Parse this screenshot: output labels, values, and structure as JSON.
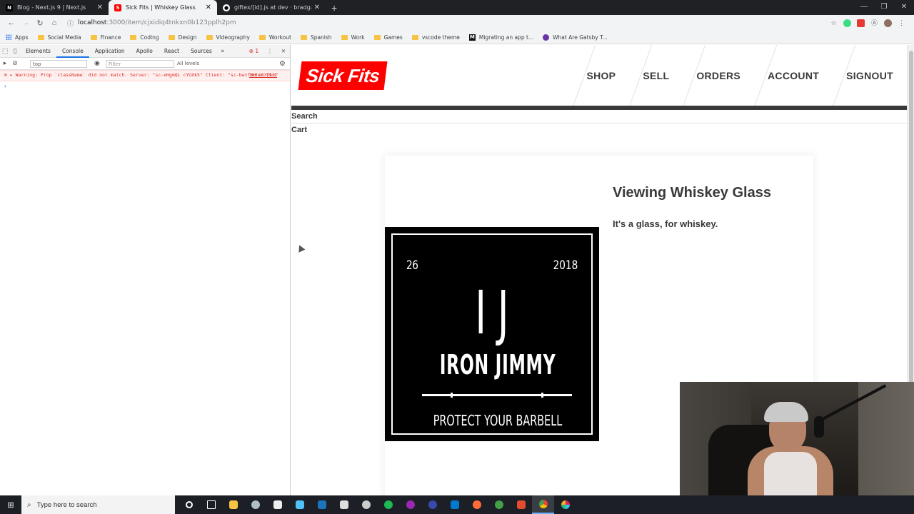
{
  "browser": {
    "tabs": [
      {
        "title": "Blog - Next.js 9 | Next.js",
        "icon": "nextjs-favicon",
        "active": false
      },
      {
        "title": "Sick Fits | Whiskey Glass",
        "icon": "sickfits-favicon",
        "active": true
      },
      {
        "title": "giftex/[id].js at dev · bradgarrop...",
        "icon": "github-favicon",
        "active": false
      }
    ],
    "url_host": "localhost",
    "url_path": ":3000/item/cjxidiq4tnkxn0b123pplh2pm",
    "bookmarks": [
      {
        "label": "Apps",
        "icon": "apps-grid-icon"
      },
      {
        "label": "Social Media",
        "icon": "folder-icon"
      },
      {
        "label": "Finance",
        "icon": "folder-icon"
      },
      {
        "label": "Coding",
        "icon": "folder-icon"
      },
      {
        "label": "Design",
        "icon": "folder-icon"
      },
      {
        "label": "Videography",
        "icon": "folder-icon"
      },
      {
        "label": "Workout",
        "icon": "folder-icon"
      },
      {
        "label": "Spanish",
        "icon": "folder-icon"
      },
      {
        "label": "Work",
        "icon": "folder-icon"
      },
      {
        "label": "Games",
        "icon": "folder-icon"
      },
      {
        "label": "vscode theme",
        "icon": "folder-icon"
      },
      {
        "label": "Migrating an app t...",
        "icon": "medium-icon"
      },
      {
        "label": "What Are Gatsby T...",
        "icon": "gatsby-icon"
      }
    ]
  },
  "devtools": {
    "tabs": [
      "Elements",
      "Console",
      "Application",
      "Apollo",
      "React",
      "Sources"
    ],
    "active_tab": "Console",
    "error_count": "1",
    "context": "top",
    "filter_placeholder": "Filter",
    "levels": "All levels",
    "error_message": "Warning: Prop `className` did not match. Server: \"sc-eHgmQL cYUXk5\" Client: \"sc-bwzfXH i5YTbb\"",
    "error_source": "index.js:1",
    "prompt": "›"
  },
  "site": {
    "logo": "Sick Fits",
    "nav": [
      "SHOP",
      "SELL",
      "ORDERS",
      "ACCOUNT",
      "SIGNOUT"
    ],
    "search_label": "Search",
    "cart_label": "Cart",
    "item": {
      "heading": "Viewing Whiskey Glass",
      "description": "It's a glass, for whiskey.",
      "image": {
        "left_number": "26",
        "right_number": "2018",
        "monogram": "IJ",
        "brand": "IRON JIMMY",
        "tagline": "PROTECT YOUR BARBELL"
      }
    },
    "colors": {
      "brand_red": "#ff0000",
      "text": "#393939"
    }
  },
  "taskbar": {
    "search_placeholder": "Type here to search",
    "apps": [
      "cortana",
      "task-view",
      "file-explorer",
      "app",
      "calculator",
      "app",
      "steam",
      "epic-games",
      "app",
      "spotify",
      "app",
      "app",
      "vscode",
      "postman",
      "app",
      "git",
      "chrome",
      "slack"
    ]
  }
}
